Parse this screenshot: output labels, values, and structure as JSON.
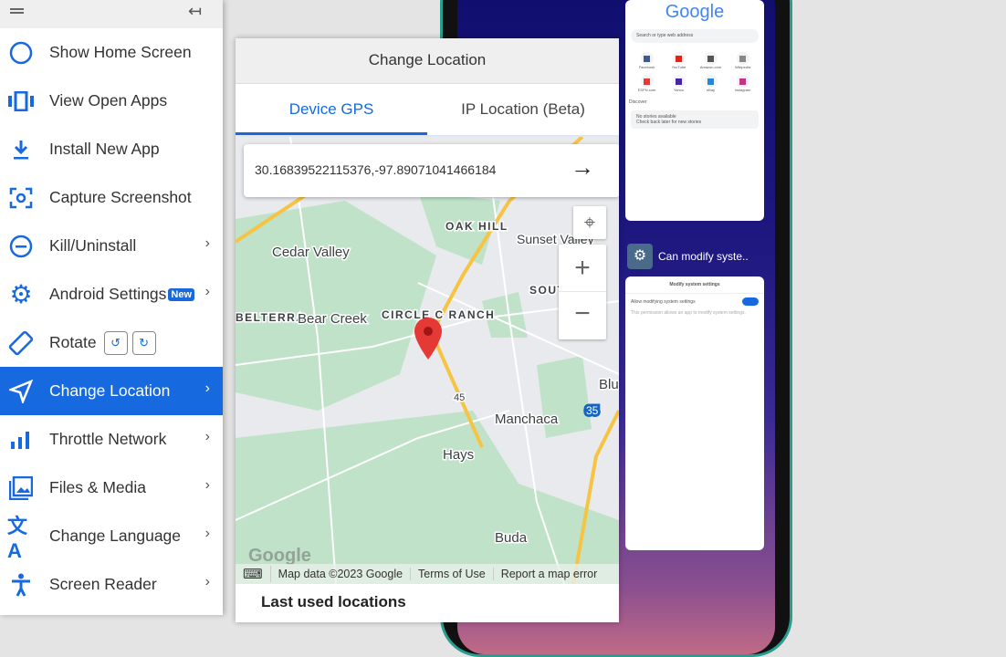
{
  "sidebar": {
    "items": [
      {
        "label": "Show Home Screen",
        "icon": "circle-icon"
      },
      {
        "label": "View Open Apps",
        "icon": "apps-icon"
      },
      {
        "label": "Install New App",
        "icon": "download-icon"
      },
      {
        "label": "Capture Screenshot",
        "icon": "screenshot-icon"
      },
      {
        "label": "Kill/Uninstall",
        "icon": "minus-circle-icon"
      },
      {
        "label": "Android Settings",
        "icon": "gear-icon",
        "badge": "New"
      },
      {
        "label": "Rotate",
        "icon": "rotate-icon"
      },
      {
        "label": "Change Location",
        "icon": "navigation-icon",
        "active": true
      },
      {
        "label": "Throttle Network",
        "icon": "signal-icon"
      },
      {
        "label": "Files & Media",
        "icon": "image-icon"
      },
      {
        "label": "Change Language",
        "icon": "translate-icon"
      },
      {
        "label": "Screen Reader",
        "icon": "accessibility-icon"
      }
    ],
    "accent": "#1769e0"
  },
  "panel": {
    "title": "Change Location",
    "tabs": [
      "Device GPS",
      "IP Location (Beta)"
    ],
    "active_tab": 0,
    "coordinates": "30.16839522115376,-97.89071041466184",
    "map_labels": [
      "OAK HILL",
      "Sunset Valley",
      "Cedar Valley",
      "SOUT",
      "BELTERRA",
      "Bear Creek",
      "CIRCLE C RANCH",
      "Blu",
      "45",
      "35",
      "Manchaca",
      "Hays",
      "Buda"
    ],
    "attribution": {
      "logo": "Google",
      "data": "Map data ©2023 Google",
      "terms": "Terms of Use",
      "report": "Report a map error"
    },
    "last_used_title": "Last used locations"
  },
  "phone": {
    "chrome_logo": "Google",
    "search_placeholder": "Search or type web address",
    "shortcuts": [
      "Facebook",
      "YouTube",
      "Amazon.com",
      "Wikipedia",
      "ESPN.com",
      "Yahoo",
      "eBay",
      "Instagram"
    ],
    "discover": "Discover",
    "no_stories": "No stories available",
    "check_back": "Check back later for new stories",
    "app_label": "Can modify syste..",
    "settings_title": "Modify system settings",
    "allow_label": "Allow modifying system settings",
    "allow_desc": "This permission allows an app to modify system settings."
  }
}
